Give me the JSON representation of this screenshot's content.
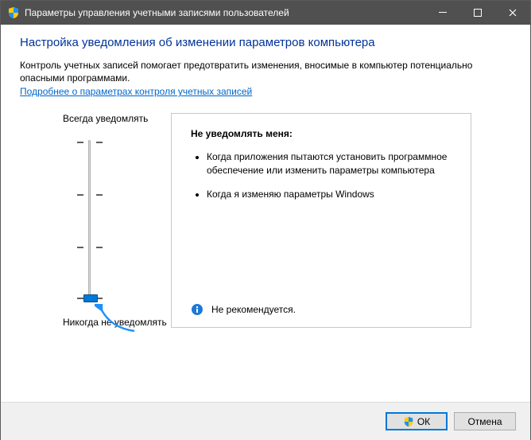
{
  "window": {
    "title": "Параметры управления учетными записями пользователей"
  },
  "heading": "Настройка уведомления об изменении параметров компьютера",
  "description": "Контроль учетных записей помогает предотвратить изменения, вносимые в компьютер потенциально опасными программами.",
  "link": "Подробнее о параметрах контроля учетных записей",
  "slider": {
    "top_label": "Всегда уведомлять",
    "bottom_label": "Никогда не уведомлять",
    "level": 0,
    "levels_total": 4
  },
  "panel": {
    "title": "Не уведомлять меня:",
    "bullets": [
      "Когда приложения пытаются установить программное обеспечение или изменить параметры компьютера",
      "Когда я изменяю параметры Windows"
    ],
    "recommendation": "Не рекомендуется."
  },
  "buttons": {
    "ok": "ОК",
    "cancel": "Отмена"
  }
}
